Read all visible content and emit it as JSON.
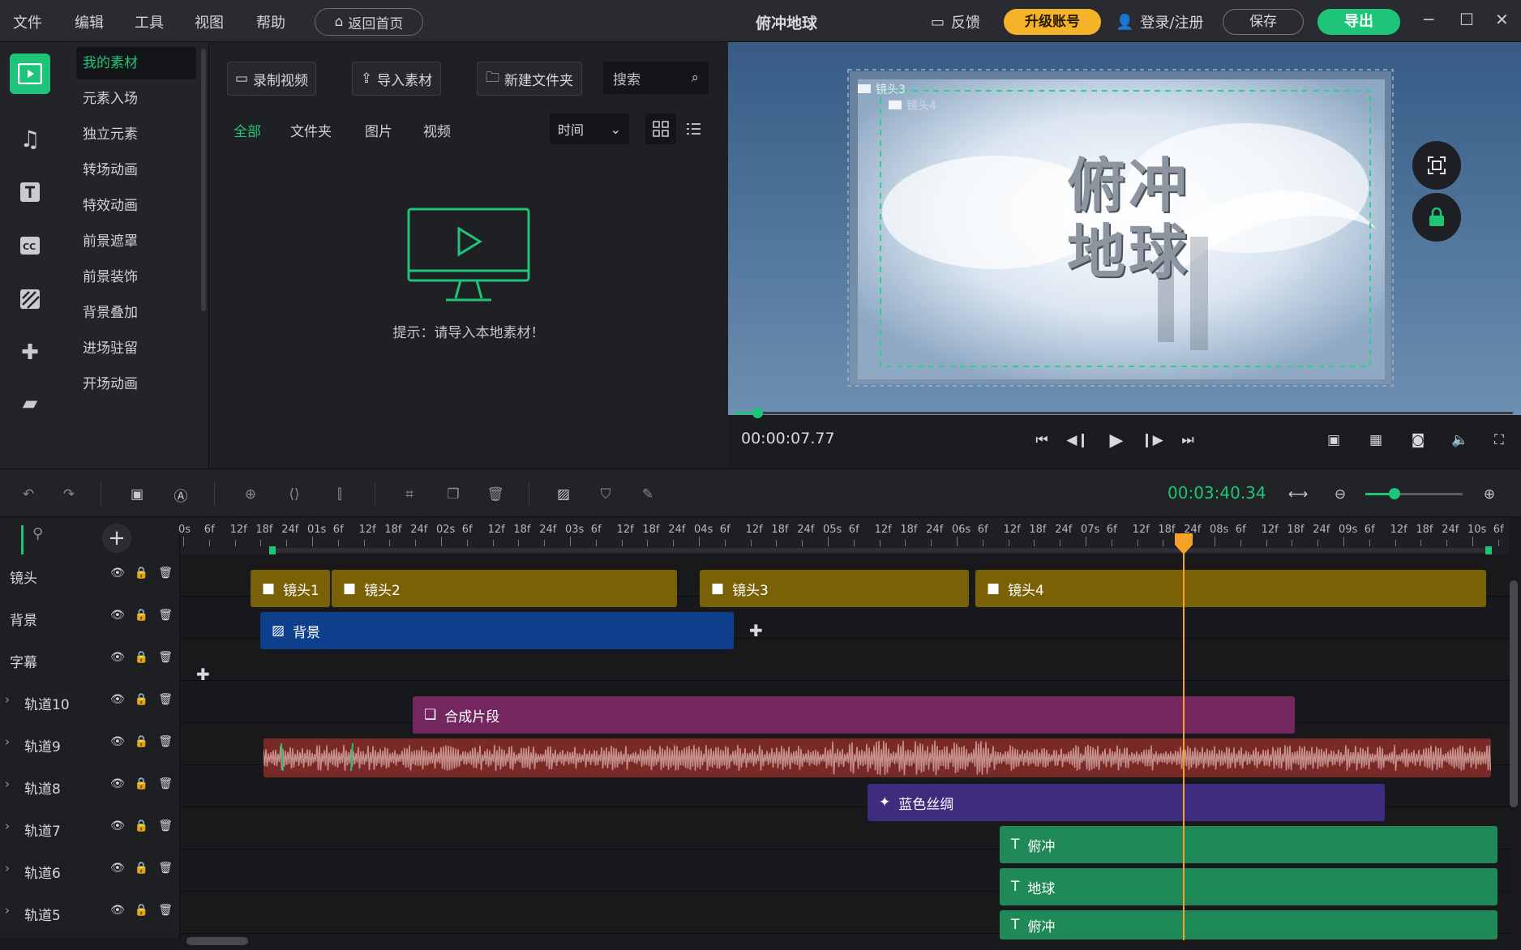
{
  "menu": [
    "文件",
    "编辑",
    "工具",
    "视图",
    "帮助"
  ],
  "home_label": "返回首页",
  "app_title": "俯冲地球",
  "feedback_label": "反馈",
  "upgrade_label": "升级账号",
  "login_label": "登录/注册",
  "save_label": "保存",
  "export_label": "导出",
  "categories": [
    "我的素材",
    "元素入场",
    "独立元素",
    "转场动画",
    "特效动画",
    "前景遮罩",
    "前景装饰",
    "背景叠加",
    "进场驻留",
    "开场动画"
  ],
  "library": {
    "record_label": "录制视频",
    "import_label": "导入素材",
    "new_folder_label": "新建文件夹",
    "search_placeholder": "搜索",
    "filters": [
      "全部",
      "文件夹",
      "图片",
      "视频"
    ],
    "sort_label": "时间",
    "hint": "提示：请导入本地素材！"
  },
  "preview": {
    "current_time": "00:00:07.77",
    "title_line1": "俯冲",
    "title_line2": "地球",
    "overlay_label_1": "镜头3",
    "overlay_label_2": "镜头4"
  },
  "toolbar": {
    "total_time": "00:03:40.34",
    "zoom_level": 0.3
  },
  "ruler_labels": [
    "0s",
    "6f",
    "12f",
    "18f",
    "24f",
    "01s",
    "6f",
    "12f",
    "18f",
    "24f",
    "02s",
    "6f",
    "12f",
    "18f",
    "24f",
    "03s",
    "6f",
    "12f",
    "18f",
    "24f",
    "04s",
    "6f",
    "12f",
    "18f",
    "24f",
    "05s",
    "6f",
    "12f",
    "18f",
    "24f",
    "06s",
    "6f",
    "12f",
    "18f",
    "24f",
    "07s",
    "6f",
    "12f",
    "18f",
    "24f",
    "08s",
    "6f",
    "12f",
    "18f",
    "24f",
    "09s",
    "6f",
    "12f",
    "18f",
    "24f",
    "10s",
    "6f"
  ],
  "tracks": [
    {
      "name": "镜头",
      "expandable": false
    },
    {
      "name": "背景",
      "expandable": false
    },
    {
      "name": "字幕",
      "expandable": false
    },
    {
      "name": "轨道10",
      "expandable": true
    },
    {
      "name": "轨道9",
      "expandable": true
    },
    {
      "name": "轨道8",
      "expandable": true
    },
    {
      "name": "轨道7",
      "expandable": true
    },
    {
      "name": "轨道6",
      "expandable": true
    },
    {
      "name": "轨道5",
      "expandable": true
    }
  ],
  "clips": {
    "shot1": "镜头1",
    "shot2": "镜头2",
    "shot3": "镜头3",
    "shot4": "镜头4",
    "background": "背景",
    "composite": "合成片段",
    "blue_silk": "蓝色丝绸",
    "text1": "俯冲",
    "text2": "地球",
    "text3": "俯冲"
  },
  "colors": {
    "accent": "#1ec578",
    "upgrade": "#f4b328",
    "shot_clip": "#7a6108",
    "bg_clip": "#0d3f8c",
    "composite_clip": "#74265e",
    "audio_clip": "#7a2a26",
    "effect_clip": "#3e2d7e",
    "text_clip": "#1f8a57",
    "playhead": "#f7a126"
  }
}
